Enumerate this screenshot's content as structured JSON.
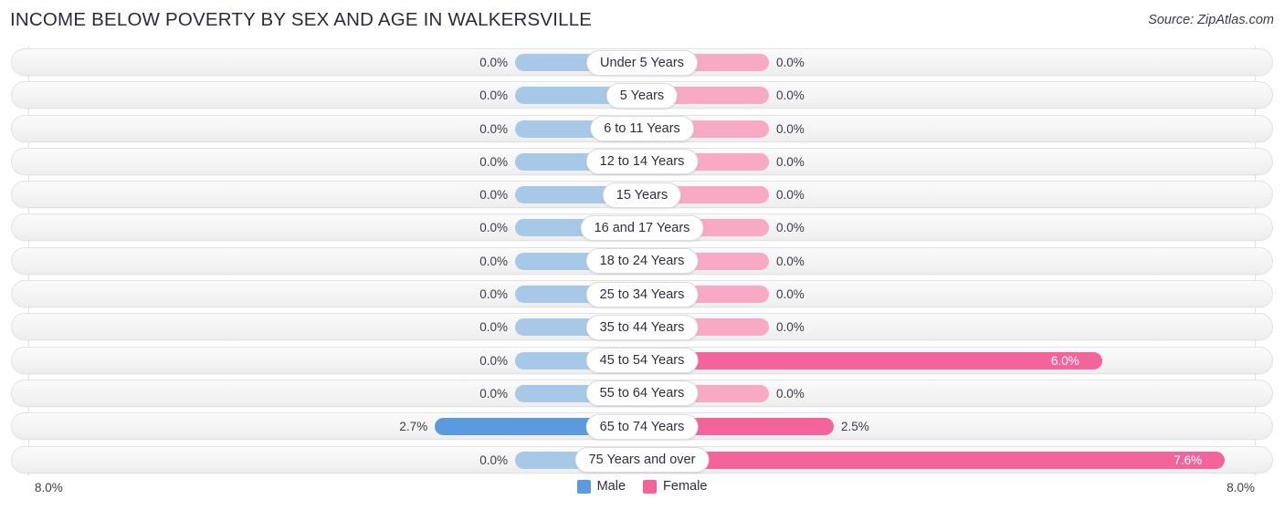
{
  "header": {
    "title": "INCOME BELOW POVERTY BY SEX AND AGE IN WALKERSVILLE",
    "source": "Source: ZipAtlas.com"
  },
  "axis": {
    "left_label": "8.0%",
    "right_label": "8.0%"
  },
  "legend": {
    "items": [
      {
        "label": "Male",
        "color": "#5b9bdd"
      },
      {
        "label": "Female",
        "color": "#f3659a"
      }
    ]
  },
  "colors": {
    "male_strong": "#5b9bdd",
    "male_muted": "#a8c8e8",
    "female_strong": "#f3659a",
    "female_muted": "#f8a9c4",
    "track_bg": "#f4f4f4",
    "gridline": "#e2e2e6",
    "text": "#3c3c46"
  },
  "chart_data": {
    "type": "bar",
    "orientation": "horizontal-diverging",
    "title": "Income Below Poverty by Sex and Age in Walkersville",
    "xlabel": "",
    "ylabel": "",
    "xlim": [
      8.0,
      8.0
    ],
    "axis_max_percent": 8.0,
    "grid": true,
    "legend_position": "bottom-center",
    "categories": [
      "Under 5 Years",
      "5 Years",
      "6 to 11 Years",
      "12 to 14 Years",
      "15 Years",
      "16 and 17 Years",
      "18 to 24 Years",
      "25 to 34 Years",
      "35 to 44 Years",
      "45 to 54 Years",
      "55 to 64 Years",
      "65 to 74 Years",
      "75 Years and over"
    ],
    "series": [
      {
        "name": "Male",
        "values": [
          0.0,
          0.0,
          0.0,
          0.0,
          0.0,
          0.0,
          0.0,
          0.0,
          0.0,
          0.0,
          0.0,
          2.7,
          0.0
        ],
        "labels": [
          "0.0%",
          "0.0%",
          "0.0%",
          "0.0%",
          "0.0%",
          "0.0%",
          "0.0%",
          "0.0%",
          "0.0%",
          "0.0%",
          "0.0%",
          "2.7%",
          "0.0%"
        ]
      },
      {
        "name": "Female",
        "values": [
          0.0,
          0.0,
          0.0,
          0.0,
          0.0,
          0.0,
          0.0,
          0.0,
          0.0,
          6.0,
          0.0,
          2.5,
          7.6
        ],
        "labels": [
          "0.0%",
          "0.0%",
          "0.0%",
          "0.0%",
          "0.0%",
          "0.0%",
          "0.0%",
          "0.0%",
          "0.0%",
          "6.0%",
          "0.0%",
          "2.5%",
          "7.6%"
        ]
      }
    ]
  }
}
